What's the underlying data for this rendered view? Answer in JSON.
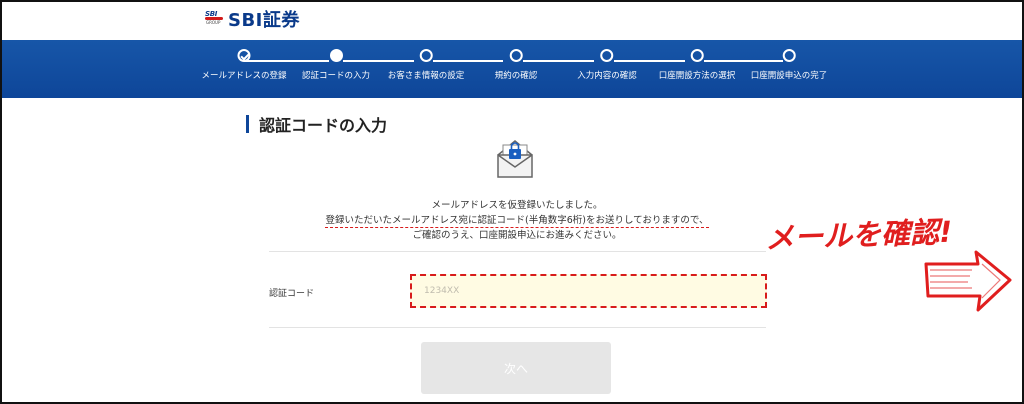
{
  "brand": {
    "logo_small": "SBI",
    "logo_group": "GROUP",
    "logo_text": "SBI証券"
  },
  "progress": {
    "steps": [
      {
        "label": "メールアドレスの登録",
        "state": "done"
      },
      {
        "label": "認証コードの入力",
        "state": "current"
      },
      {
        "label": "お客さま情報の設定",
        "state": "todo"
      },
      {
        "label": "規約の確認",
        "state": "todo"
      },
      {
        "label": "入力内容の確認",
        "state": "todo"
      },
      {
        "label": "口座開設方法の選択",
        "state": "todo"
      },
      {
        "label": "口座開設申込の完了",
        "state": "todo"
      }
    ]
  },
  "main": {
    "title": "認証コードの入力",
    "message_line1": "メールアドレスを仮登録いたしました。",
    "message_line2": "登録いただいたメールアドレス宛に認証コード(半角数字6桁)をお送りしておりますので、",
    "message_line3": "ご確認のうえ、口座開設申込にお進みください。",
    "code_label": "認証コード",
    "code_placeholder": "1234XX",
    "code_value": "",
    "next_label": "次へ"
  },
  "annotation": {
    "text": "メールを確認!"
  },
  "colors": {
    "brand_blue": "#0e4699",
    "annotation_red": "#e01e1e",
    "input_bg": "#fffbe3"
  },
  "icons": {
    "envelope": "envelope-lock-icon",
    "arrow": "right-arrow-icon"
  }
}
